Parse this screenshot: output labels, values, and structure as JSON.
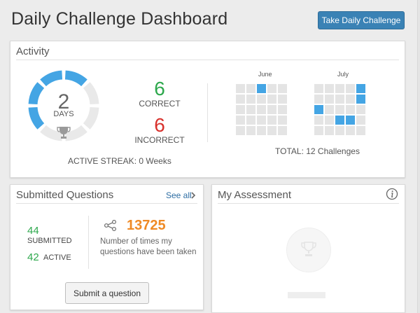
{
  "header": {
    "title": "Daily Challenge Dashboard",
    "cta_label": "Take Daily Challenge"
  },
  "activity": {
    "title": "Activity",
    "streak": {
      "value": "2",
      "unit": "DAYS",
      "active_streak": "ACTIVE STREAK: 0 Weeks",
      "filled_segments": 4,
      "total_segments": 8
    },
    "correct": {
      "value": "6",
      "label": "CORRECT"
    },
    "incorrect": {
      "value": "6",
      "label": "INCORRECT"
    },
    "calendar": {
      "months": [
        {
          "label": "June",
          "active": [
            [
              0,
              2
            ]
          ]
        },
        {
          "label": "July",
          "active": [
            [
              0,
              4
            ],
            [
              1,
              4
            ],
            [
              2,
              0
            ],
            [
              3,
              2
            ],
            [
              3,
              3
            ]
          ]
        }
      ],
      "total": "TOTAL: 12 Challenges"
    },
    "colors": {
      "accent": "#44a5e4",
      "track": "#e9e9e9",
      "correct": "#2ea84d",
      "incorrect": "#d8312c"
    }
  },
  "submitted": {
    "title": "Submitted Questions",
    "see_all": "See all",
    "submitted_count": "44",
    "submitted_label": "SUBMITTED",
    "active_count": "42",
    "active_label": "ACTIVE",
    "taken_count": "13725",
    "taken_label": "Number of times my questions have been taken",
    "submit_button": "Submit a question"
  },
  "assessment": {
    "title": "My Assessment",
    "info_icon": "info-icon"
  }
}
